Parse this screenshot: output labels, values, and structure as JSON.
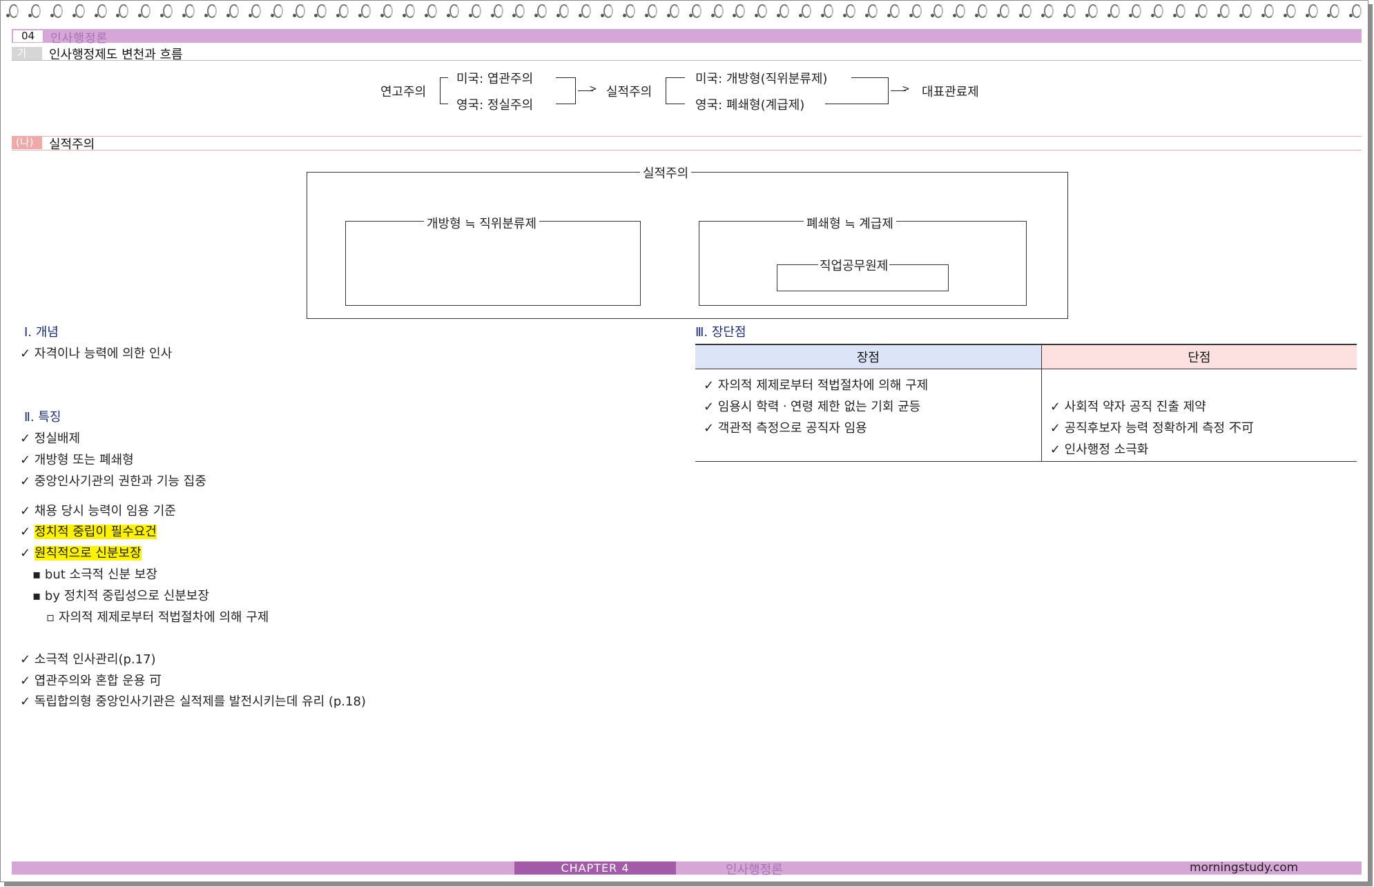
{
  "header": {
    "number": "04",
    "title": "인사행정론"
  },
  "section_ga": {
    "marker": "가",
    "title": "인사행정제도 변천과 흐름"
  },
  "flow": {
    "start": "연고주의",
    "us_spoils": "미국: 엽관주의",
    "uk_patronage": "영국: 정실주의",
    "merit": "실적주의",
    "us_open": "미국: 개방형(직위분류제)",
    "uk_closed": "영국: 폐쇄형(계급제)",
    "end": "대표관료제"
  },
  "section_na": {
    "marker": "(나)",
    "title": "실적주의"
  },
  "diagram": {
    "outer": "실적주의",
    "open": "개방형 ≒ 직위분류제",
    "closed": "폐쇄형 ≒ 계급제",
    "career": "직업공무원제"
  },
  "concept": {
    "heading": "Ⅰ. 개념",
    "items": [
      "✓ 자격이나 능력에 의한 인사"
    ]
  },
  "features": {
    "heading": "Ⅱ. 특징",
    "items": [
      "✓ 정실배제",
      "✓ 개방형 또는 폐쇄형",
      "✓ 중앙인사기관의 권한과 기능 집중",
      "✓ 채용 당시 능력이 임용 기준",
      "정치적 중립이 필수요건",
      "원칙적으로 신분보장",
      "▪ but 소극적 신분 보장",
      "▪ by 정치적 중립성으로 신분보장",
      "▫ 자의적 제제로부터 적법절차에 의해 구제",
      "✓ 소극적 인사관리(p.17)",
      "✓ 엽관주의와 혼합 운용 可",
      "✓ 독립합의형 중앙인사기관은 실적제를 발전시키는데 유리 (p.18)"
    ],
    "check": "✓"
  },
  "pros_cons": {
    "heading": "Ⅲ. 장단점",
    "pro_header": "장점",
    "con_header": "단점",
    "pros": [
      "✓ 자의적 제제로부터 적법절차에 의해 구제",
      "✓ 임용시 학력ㆍ연령 제한 없는 기회 균등",
      "✓ 객관적 측정으로 공직자 임용"
    ],
    "cons": [
      "✓ 사회적 약자 공직 진출 제약",
      "✓ 공직후보자 능력 정확하게 측정 不可",
      "✓ 인사행정 소극화"
    ]
  },
  "footer": {
    "chapter": "CHAPTER 4",
    "title": "인사행정론",
    "site": "morningstudy.com"
  },
  "colors": {
    "band": "#d5a6d6",
    "chapter": "#a25aa9",
    "highlight": "#fff200",
    "heading": "#1a2a7a",
    "pro_bg": "#dce4f7",
    "con_bg": "#fde0e0"
  }
}
